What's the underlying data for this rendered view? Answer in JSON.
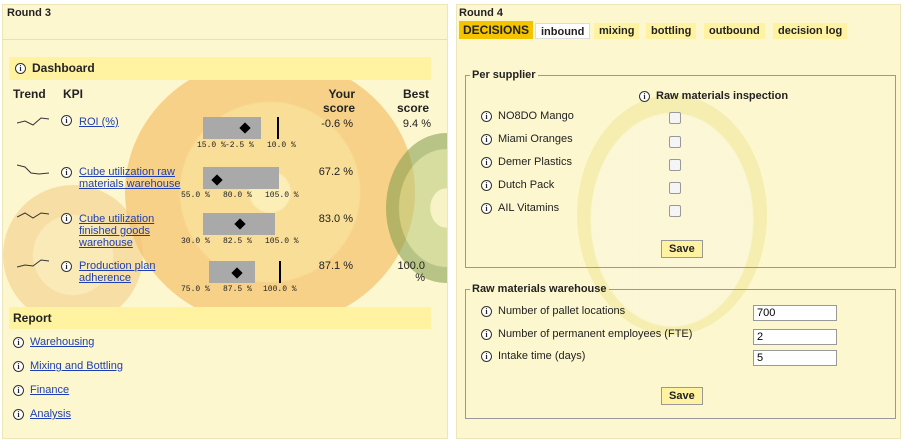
{
  "left": {
    "round_label": "Round 3",
    "dashboard": {
      "title": "Dashboard",
      "headers": {
        "trend": "Trend",
        "kpi": "KPI",
        "your_score": "Your score",
        "best_score": "Best score"
      },
      "kpis": [
        {
          "label": "ROI (%)",
          "your": "-0.6 %",
          "best": "9.4 %",
          "ticks": [
            "15.0 %",
            "-2.5 %",
            "10.0 %"
          ]
        },
        {
          "label": "Cube utilization raw materials warehouse",
          "your": "67.2 %",
          "best": "",
          "ticks": [
            "55.0 %",
            "80.0 %",
            "105.0 %"
          ]
        },
        {
          "label": "Cube utilization finished goods warehouse",
          "your": "83.0 %",
          "best": "",
          "ticks": [
            "30.0 %",
            "82.5 %",
            "105.0 %"
          ]
        },
        {
          "label": "Production plan adherence",
          "your": "87.1 %",
          "best": "100.0 %",
          "ticks": [
            "75.0 %",
            "87.5 %",
            "100.0 %"
          ]
        }
      ]
    },
    "report": {
      "title": "Report",
      "links": [
        "Warehousing",
        "Mixing and Bottling",
        "Finance",
        "Analysis"
      ]
    }
  },
  "right": {
    "round_label": "Round 4",
    "decisions_label": "DECISIONS",
    "tabs": [
      "inbound",
      "mixing",
      "bottling",
      "outbound",
      "decision log"
    ],
    "active_tab": "inbound",
    "per_supplier": {
      "legend": "Per supplier",
      "column_header": "Raw materials inspection",
      "suppliers": [
        "NO8DO Mango",
        "Miami Oranges",
        "Demer Plastics",
        "Dutch Pack",
        "AIL Vitamins"
      ],
      "save_label": "Save"
    },
    "warehouse": {
      "legend": "Raw materials warehouse",
      "fields": [
        {
          "label": "Number of pallet locations",
          "value": "700"
        },
        {
          "label": "Number of permanent employees (FTE)",
          "value": "2"
        },
        {
          "label": "Intake time (days)",
          "value": "5"
        }
      ],
      "save_label": "Save"
    }
  },
  "info_glyph": "i",
  "icons": [
    "info-icon",
    "trend-sparkline-icon"
  ]
}
